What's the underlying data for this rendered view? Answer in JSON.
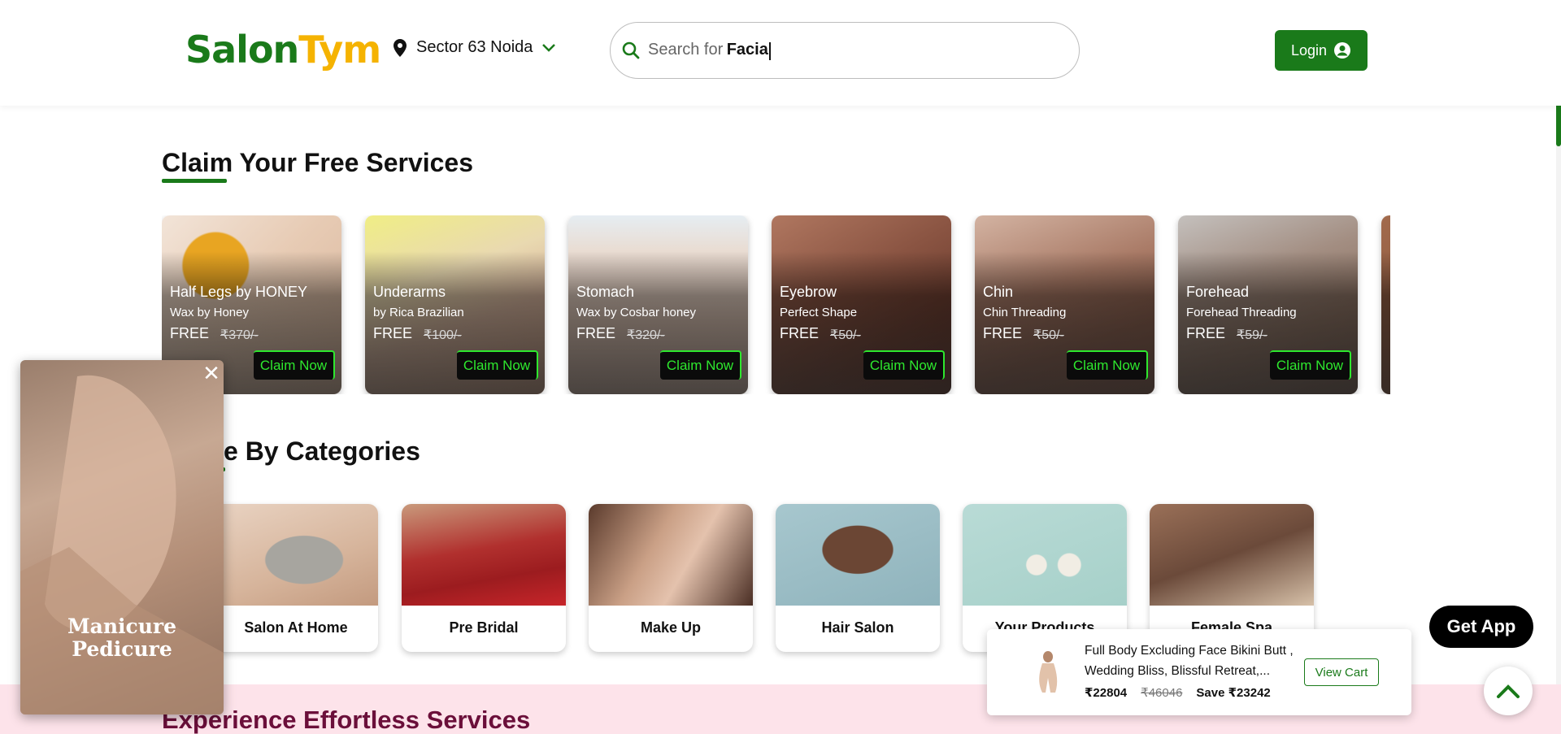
{
  "header": {
    "logo_part1": "Salon",
    "logo_part2": "Tym",
    "location": "Sector 63 Noida",
    "search_placeholder": "Search for",
    "search_value": "Facia",
    "login_label": "Login"
  },
  "free_services": {
    "title": "Claim Your Free Services",
    "cards": [
      {
        "title": "Half Legs by HONEY",
        "subtitle": "Wax by Honey",
        "price": "FREE",
        "old_price": "₹370/-",
        "cta": "Claim Now"
      },
      {
        "title": "Underarms",
        "subtitle": "by Rica Brazilian",
        "price": "FREE",
        "old_price": "₹100/-",
        "cta": "Claim Now"
      },
      {
        "title": "Stomach",
        "subtitle": "Wax by Cosbar honey",
        "price": "FREE",
        "old_price": "₹320/-",
        "cta": "Claim Now"
      },
      {
        "title": "Eyebrow",
        "subtitle": "Perfect Shape",
        "price": "FREE",
        "old_price": "₹50/-",
        "cta": "Claim Now"
      },
      {
        "title": "Chin",
        "subtitle": "Chin Threading",
        "price": "FREE",
        "old_price": "₹50/-",
        "cta": "Claim Now"
      },
      {
        "title": "Forehead",
        "subtitle": "Forehead Threading",
        "price": "FREE",
        "old_price": "₹59/-",
        "cta": "Claim Now"
      }
    ]
  },
  "categories": {
    "title_visible": "ore By Categories",
    "items": [
      {
        "label": "Salon At Home"
      },
      {
        "label": "Pre Bridal"
      },
      {
        "label": "Make Up"
      },
      {
        "label": "Hair Salon"
      },
      {
        "label": "Your Products"
      },
      {
        "label": "Female Spa"
      }
    ]
  },
  "experience": {
    "title": "Experience Effortless Services"
  },
  "popup": {
    "text_line1": "Manicure",
    "text_line2": "Pedicure",
    "close": "✕"
  },
  "cart": {
    "item_name": "Full Body Excluding Face Bikini Butt , Wedding Bliss, Blissful Retreat,...",
    "price_now": "₹22804",
    "price_old": "₹46046",
    "savings": "Save ₹23242",
    "view_cart_label": "View Cart"
  },
  "get_app_label": "Get App",
  "colors": {
    "brand_green": "#1a7a1a",
    "brand_yellow": "#f5b301",
    "claim_green": "#2ee82e",
    "experience_maroon": "#6b0f3a"
  }
}
